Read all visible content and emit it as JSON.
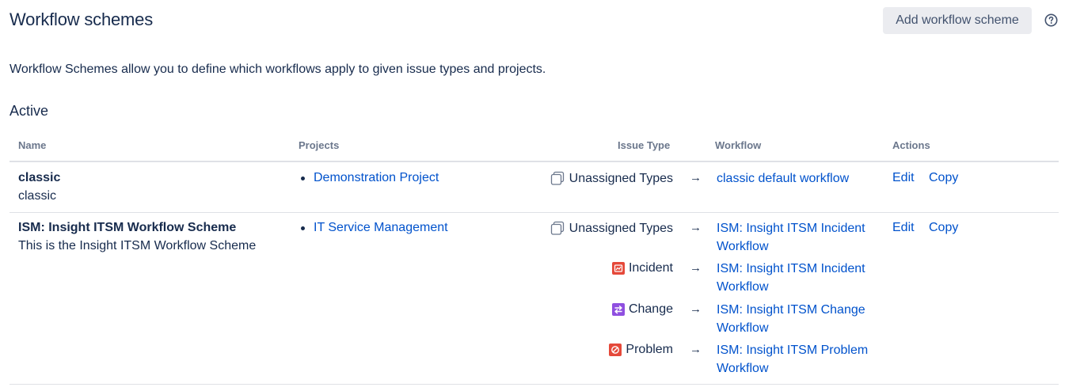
{
  "header": {
    "title": "Workflow schemes",
    "add_button": "Add workflow scheme",
    "help_icon": "help-circle-icon"
  },
  "description": "Workflow Schemes allow you to define which workflows apply to given issue types and projects.",
  "section_title": "Active",
  "columns": {
    "name": "Name",
    "projects": "Projects",
    "issue_type": "Issue Type",
    "workflow": "Workflow",
    "actions": "Actions"
  },
  "schemes": [
    {
      "name": "classic",
      "description": "classic",
      "projects": [
        "Demonstration Project"
      ],
      "mappings": [
        {
          "issue_type": "Unassigned Types",
          "icon": "unassigned-types-icon",
          "arrow": "→",
          "workflow": "classic default workflow"
        }
      ],
      "actions": {
        "edit": "Edit",
        "copy": "Copy"
      }
    },
    {
      "name": "ISM: Insight ITSM Workflow Scheme",
      "description": "This is the Insight ITSM Workflow Scheme",
      "projects": [
        "IT Service Management"
      ],
      "mappings": [
        {
          "issue_type": "Unassigned Types",
          "icon": "unassigned-types-icon",
          "arrow": "→",
          "workflow_line1": "ISM: Insight ITSM Incident",
          "workflow_line2": "Workflow"
        },
        {
          "issue_type": "Incident",
          "icon": "incident-icon",
          "color": "#e5493a",
          "arrow": "→",
          "workflow_line1": "ISM: Insight ITSM Incident",
          "workflow_line2": "Workflow"
        },
        {
          "issue_type": "Change",
          "icon": "change-icon",
          "color": "#8f4fe0",
          "arrow": "→",
          "workflow_line1": "ISM: Insight ITSM Change",
          "workflow_line2": "Workflow"
        },
        {
          "issue_type": "Problem",
          "icon": "problem-icon",
          "color": "#e5493a",
          "arrow": "→",
          "workflow_line1": "ISM: Insight ITSM Problem",
          "workflow_line2": "Workflow"
        }
      ],
      "actions": {
        "edit": "Edit",
        "copy": "Copy"
      }
    }
  ],
  "colors": {
    "link": "#0052cc",
    "text": "#172b4d",
    "header_text": "#6b778c",
    "button_bg": "#ebecf0",
    "divider": "#dfe1e6"
  }
}
